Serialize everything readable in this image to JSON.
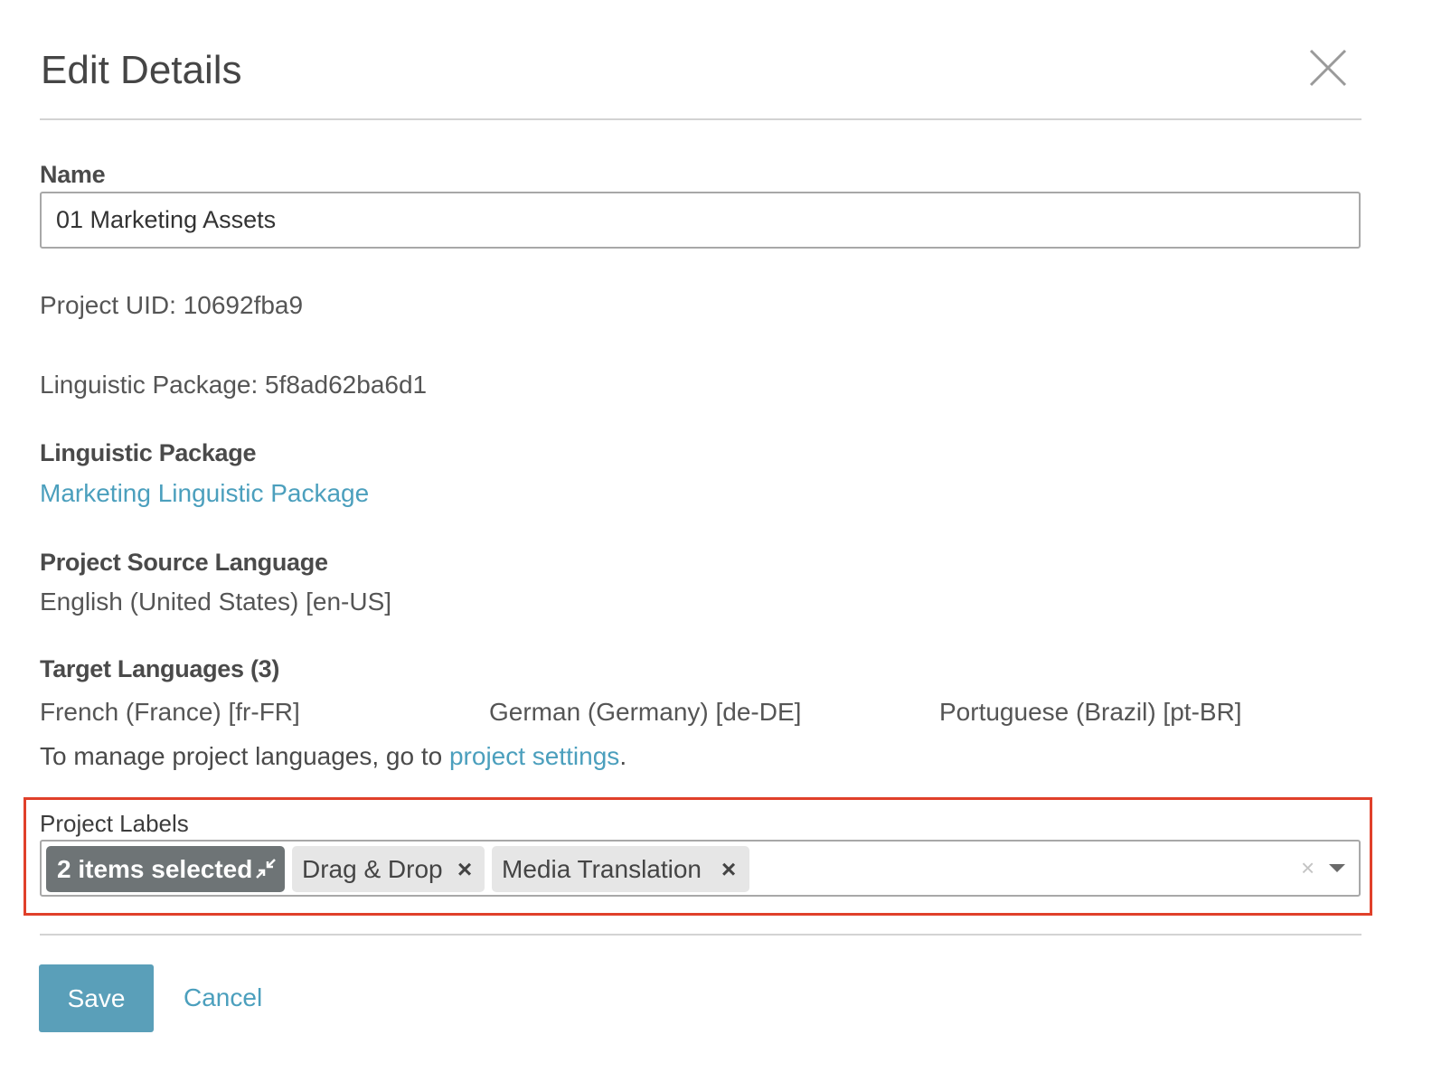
{
  "dialog": {
    "title": "Edit Details",
    "close_label": "×"
  },
  "name_field": {
    "label": "Name",
    "value": "01 Marketing Assets"
  },
  "project_uid": "Project UID: 10692fba9",
  "linguistic_package_id": "Linguistic Package: 5f8ad62ba6d1",
  "linguistic_package": {
    "label": "Linguistic Package",
    "link_text": "Marketing Linguistic Package"
  },
  "source_language": {
    "label": "Project Source Language",
    "value": "English (United States) [en-US]"
  },
  "target_languages": {
    "label": "Target Languages (3)",
    "items": [
      "French (France) [fr-FR]",
      "German (Germany) [de-DE]",
      "Portuguese (Brazil) [pt-BR]"
    ],
    "manage_prefix": "To manage project languages, go to ",
    "manage_link": "project settings",
    "manage_suffix": "."
  },
  "project_labels": {
    "label": "Project Labels",
    "summary_chip": "2 items selected",
    "tags": [
      {
        "label": "Drag & Drop",
        "remove": "×"
      },
      {
        "label": "Media Translation",
        "remove": "×"
      }
    ],
    "clear": "×"
  },
  "footer": {
    "save_label": "Save",
    "cancel_label": "Cancel"
  },
  "colors": {
    "accent": "#4b9fbd",
    "primary_button": "#5a9fb9",
    "highlight_border": "#e0402a",
    "summary_chip": "#6e7476",
    "tag_chip": "#e6e6e6"
  },
  "icons": [
    "close-icon",
    "collapse-icon",
    "clear-icon",
    "chevron-down-icon"
  ]
}
